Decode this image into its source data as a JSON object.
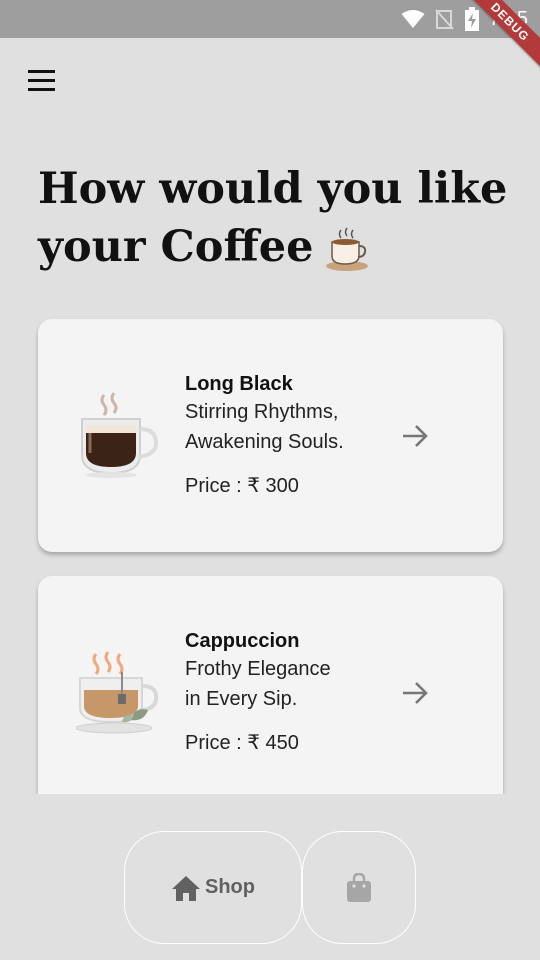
{
  "status_bar": {
    "time": "7:25",
    "debug_label": "DEBUG"
  },
  "header": {
    "menu_icon": "hamburger-menu-icon"
  },
  "page": {
    "title_line1": "How would you like",
    "title_line2": "your Coffee",
    "title_emoji_icon": "coffee-cup-icon"
  },
  "products": [
    {
      "name": "Long Black",
      "description": " Stirring Rhythms,\nAwakening Souls.",
      "price": "Price : ₹ 300",
      "icon": "long-black-glass-icon",
      "action_icon": "arrow-right-icon"
    },
    {
      "name": "Cappuccion",
      "description": " Frothy Elegance\nin Every Sip.",
      "price": "Price : ₹ 450",
      "icon": "cappuccino-cup-icon",
      "action_icon": "arrow-right-icon"
    }
  ],
  "bottom_nav": {
    "shop_label": "Shop",
    "shop_icon": "home-icon",
    "bag_icon": "shopping-bag-icon"
  },
  "colors": {
    "background": "#e0e0e0",
    "card": "#f4f4f4",
    "status_bar": "#9e9e9e",
    "debug_ribbon": "#b33a3a",
    "nav_text": "#616161"
  }
}
